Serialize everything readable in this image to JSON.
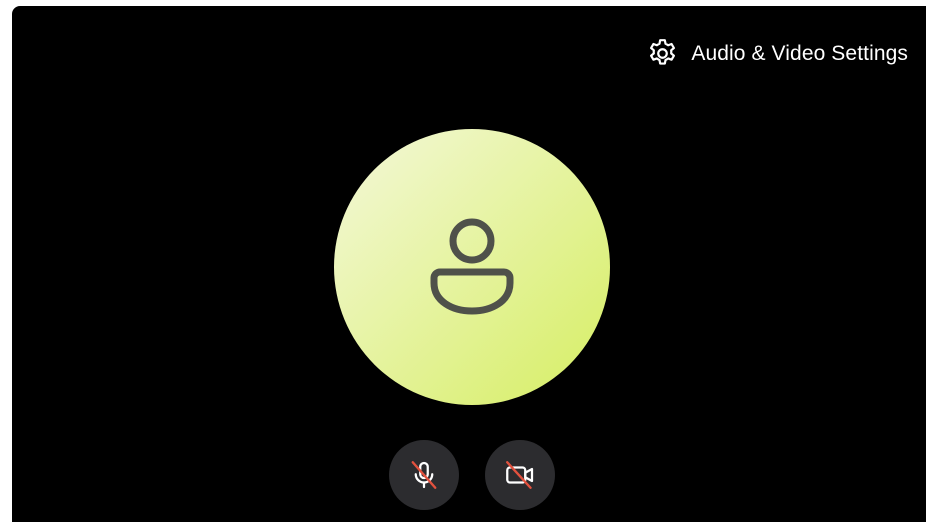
{
  "settings": {
    "label": "Audio & Video Settings",
    "icon": "gear-icon"
  },
  "avatar": {
    "icon": "person-icon",
    "gradient_start": "#f4f8da",
    "gradient_end": "#d6ee62",
    "icon_color": "#4f514a"
  },
  "controls": {
    "microphone": {
      "icon": "microphone-off-icon",
      "state": "muted"
    },
    "camera": {
      "icon": "camera-off-icon",
      "state": "off"
    },
    "slash_color": "#e2513e"
  },
  "colors": {
    "panel_background": "#000000",
    "button_background": "#2c2c2f",
    "text": "#ffffff"
  }
}
